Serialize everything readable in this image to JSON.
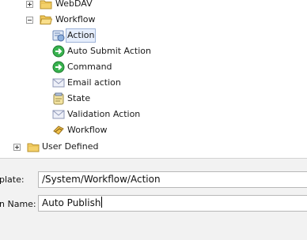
{
  "tree": {
    "items": [
      {
        "label": "WebDAV",
        "icon": "folder-icon",
        "expander": "plus"
      },
      {
        "label": "Workflow",
        "icon": "folder-open-icon",
        "expander": "minus"
      },
      {
        "label": "Action",
        "icon": "action-icon",
        "selected": true
      },
      {
        "label": "Auto Submit Action",
        "icon": "green-arrow-icon"
      },
      {
        "label": "Command",
        "icon": "green-arrow-icon"
      },
      {
        "label": "Email action",
        "icon": "envelope-icon"
      },
      {
        "label": "State",
        "icon": "state-icon"
      },
      {
        "label": "Validation Action",
        "icon": "envelope-icon"
      },
      {
        "label": "Workflow",
        "icon": "workflow-icon"
      },
      {
        "label": "User Defined",
        "icon": "folder-icon",
        "expander": "plus"
      }
    ]
  },
  "form": {
    "template_label": "plate:",
    "template_value": "/System/Workflow/Action",
    "name_label": "n Name:",
    "name_value": "Auto Publish"
  }
}
